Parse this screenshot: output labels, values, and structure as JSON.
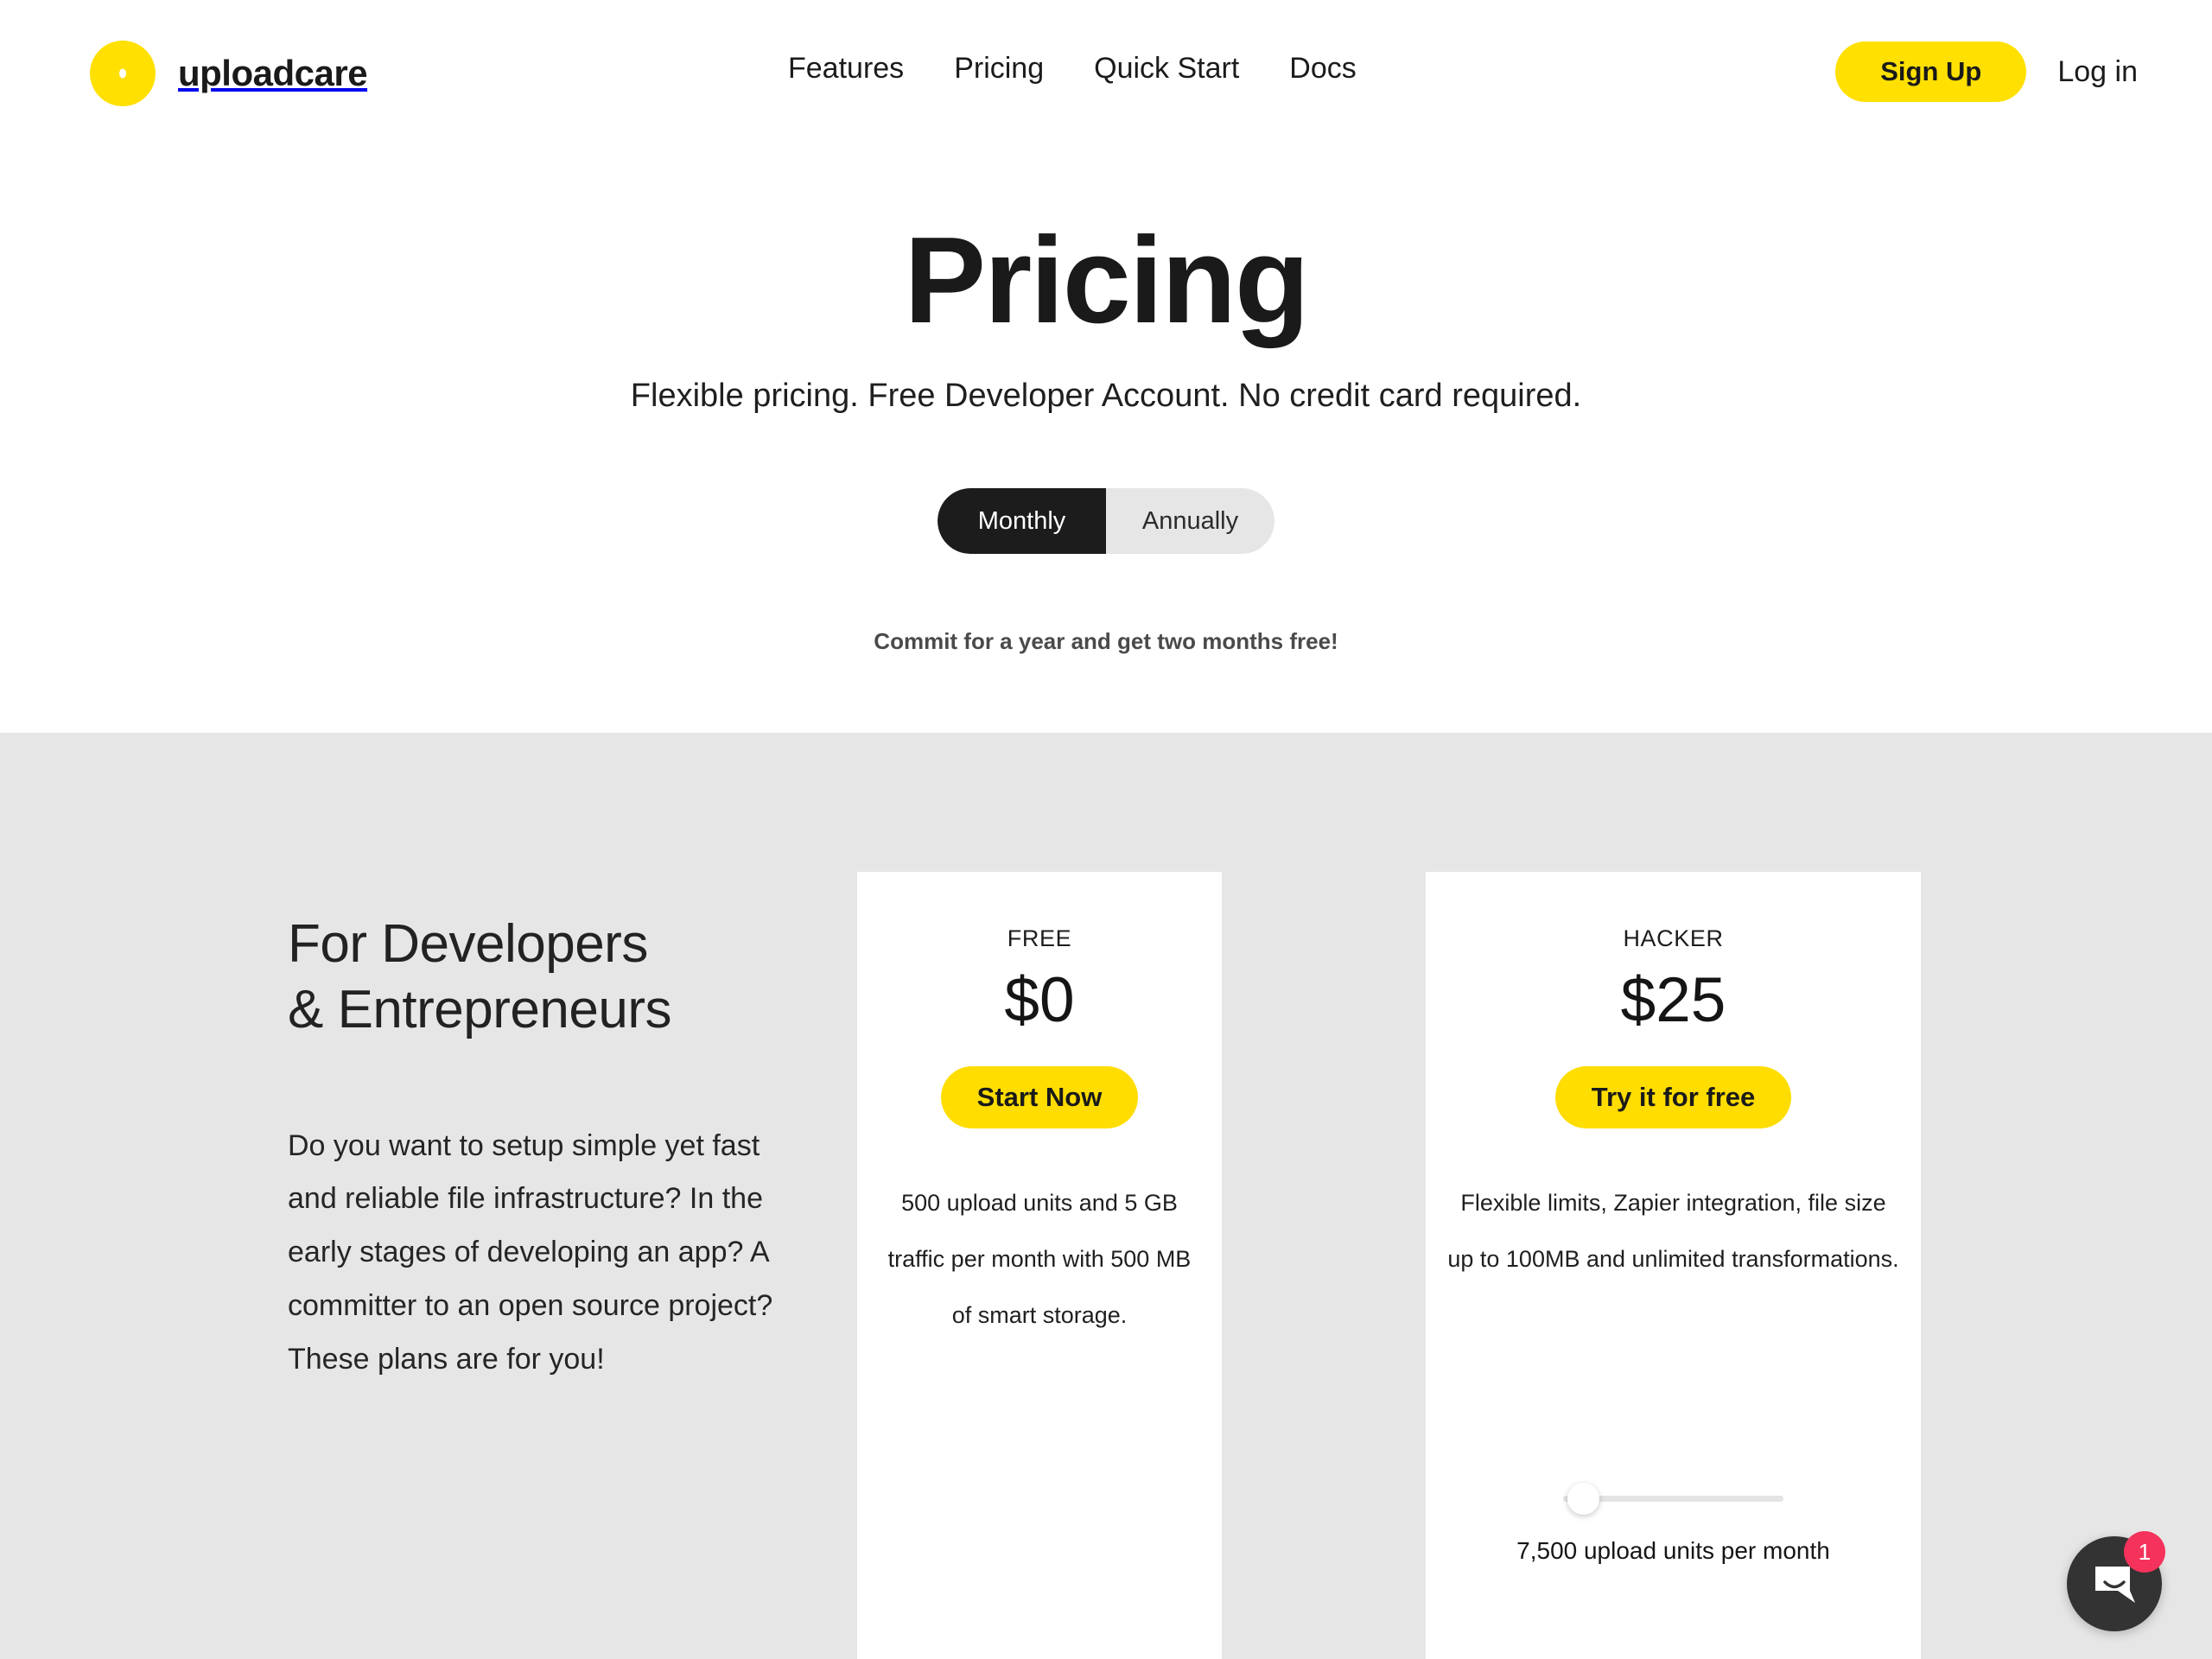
{
  "header": {
    "logo_text": "uploadcare",
    "nav": [
      {
        "label": "Features"
      },
      {
        "label": "Pricing"
      },
      {
        "label": "Quick Start"
      },
      {
        "label": "Docs"
      }
    ],
    "signup_label": "Sign Up",
    "login_label": "Log in"
  },
  "hero": {
    "title": "Pricing",
    "subtitle": "Flexible pricing. Free Developer Account. No credit card required.",
    "billing": {
      "monthly_label": "Monthly",
      "annually_label": "Annually",
      "selected": "Monthly"
    },
    "commit_note": "Commit for a year and get two months free!"
  },
  "pricing": {
    "intro": {
      "title_line1": "For Developers",
      "title_line2": "& Entrepreneurs",
      "body": "Do you want to setup simple yet fast and reliable file infrastructure? In the early stages of developing an app? A committer to an open source project? These plans are for you!"
    },
    "plans": [
      {
        "name": "FREE",
        "price": "$0",
        "cta": "Start Now",
        "description": "500 upload units and 5 GB traffic per month with 500 MB of smart storage."
      },
      {
        "name": "HACKER",
        "price": "$25",
        "cta": "Try it for free",
        "description": "Flexible limits, Zapier integration, file size up to 100MB and unlimited transformations.",
        "slider": {
          "caption": "7,500 upload units per month",
          "value_percent": 5
        }
      }
    ]
  },
  "chat": {
    "badge_count": "1",
    "icon": "chat-bubble-icon"
  },
  "colors": {
    "brand_yellow": "#FFE000",
    "cta_yellow": "#FFDD00",
    "section_gray": "#e6e6e6",
    "toggle_active": "#1c1c1c",
    "badge_red": "#F5325B",
    "chat_dark": "#333333"
  }
}
